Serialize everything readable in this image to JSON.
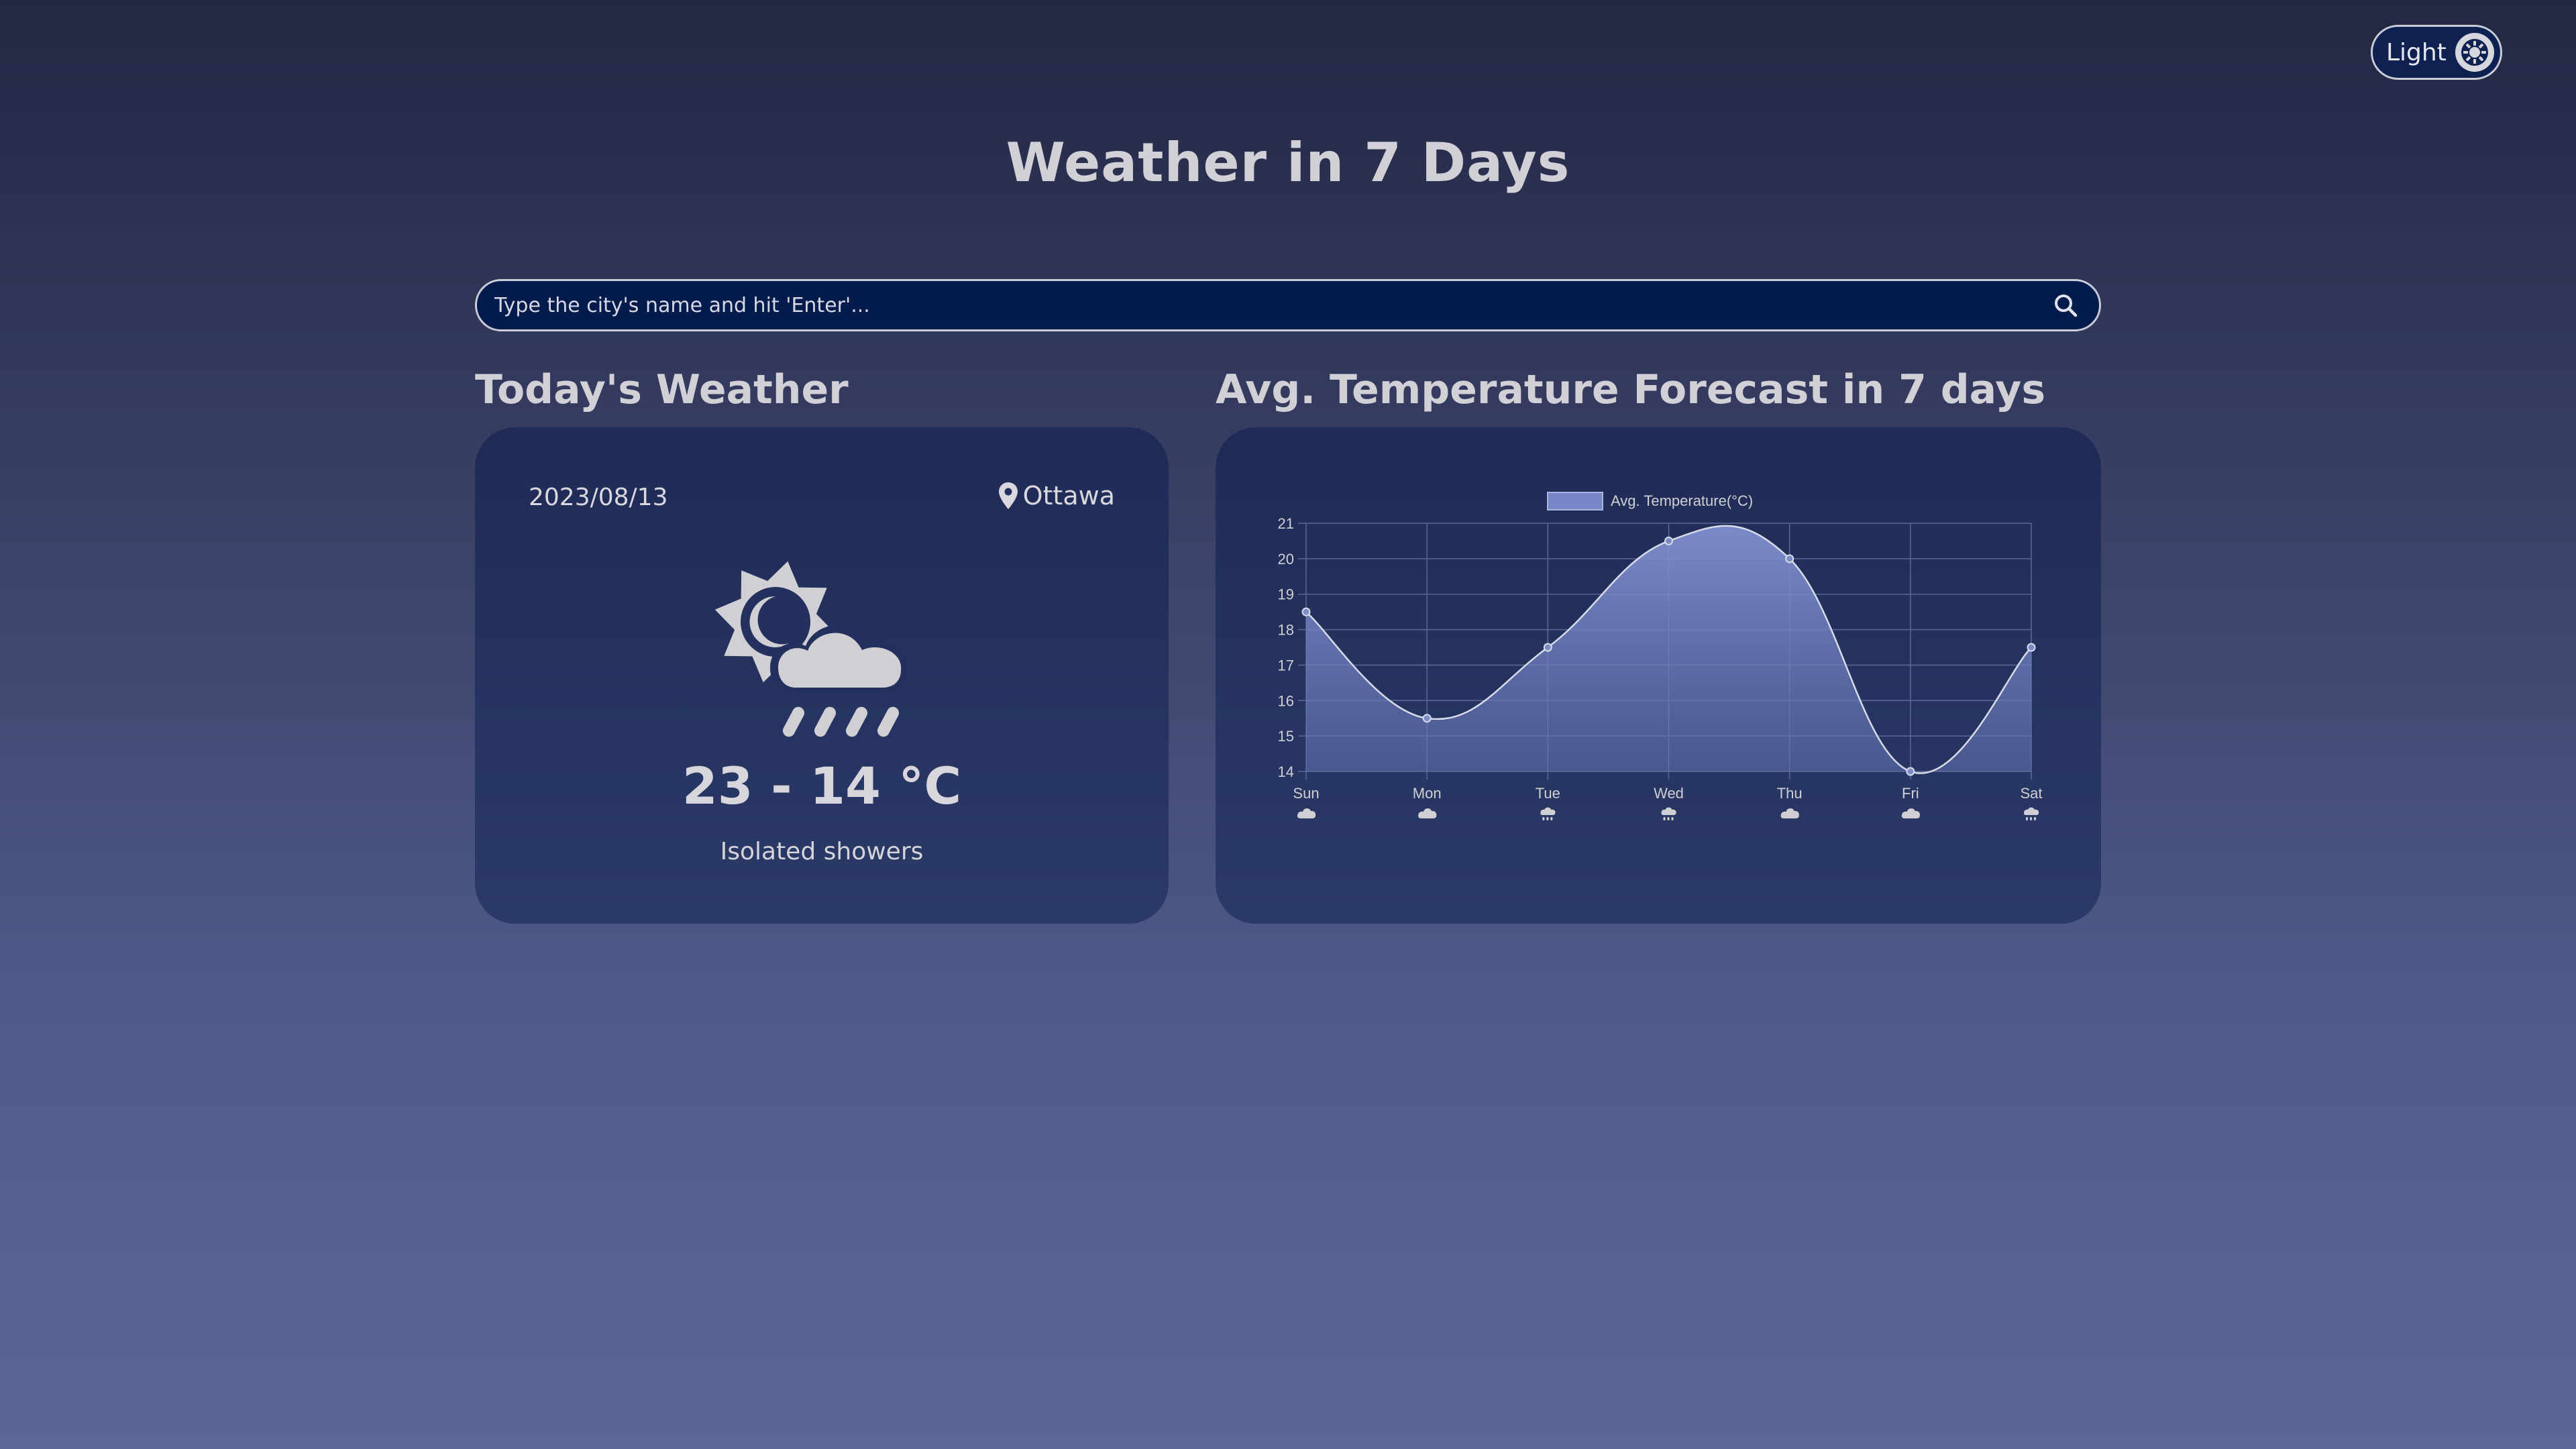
{
  "theme_toggle": {
    "label": "Light",
    "icon": "sun-gear-icon"
  },
  "page_title": "Weather in 7 Days",
  "search": {
    "placeholder": "Type the city's name and hit 'Enter'...",
    "value": "",
    "icon": "search-icon"
  },
  "today": {
    "heading": "Today's Weather",
    "date": "2023/08/13",
    "city": "Ottawa",
    "location_icon": "map-pin-icon",
    "condition_icon": "sun-cloud-rain-icon",
    "temp_range": "23 - 14 °C",
    "description": "Isolated showers"
  },
  "forecast": {
    "heading": "Avg. Temperature Forecast in 7 days"
  },
  "colors": {
    "fill": "#7887c7",
    "line": "#d8dcea",
    "text": "#cfcfd4",
    "grid": "#5b6896"
  },
  "chart_data": {
    "type": "area",
    "legend": "Avg. Temperature(°C)",
    "legend_position": "top",
    "categories": [
      "Sun",
      "Mon",
      "Tue",
      "Wed",
      "Thu",
      "Fri",
      "Sat"
    ],
    "values": [
      18.5,
      15.5,
      17.5,
      20.5,
      20,
      14,
      17.5
    ],
    "icons": [
      "cloud-icon",
      "cloud-icon",
      "cloud-rain-icon",
      "cloud-rain-icon",
      "cloud-icon",
      "cloud-icon",
      "cloud-rain-icon"
    ],
    "ylim": [
      14,
      21
    ],
    "yticks": [
      14,
      15,
      16,
      17,
      18,
      19,
      20,
      21
    ],
    "grid": true
  }
}
